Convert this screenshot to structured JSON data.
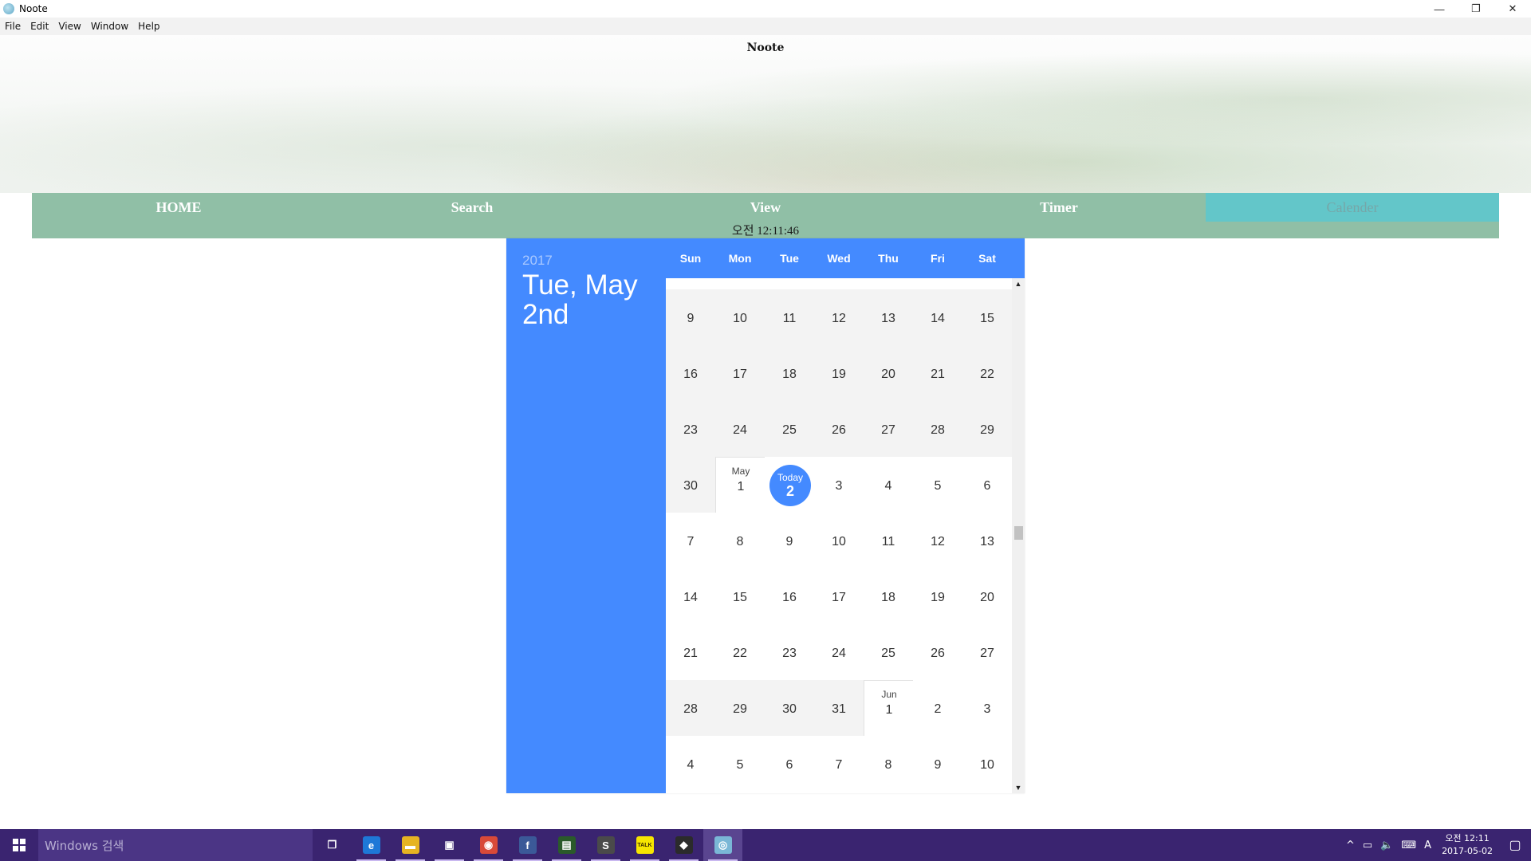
{
  "window": {
    "title": "Noote",
    "minimize_glyph": "—",
    "restore_glyph": "❐",
    "close_glyph": "✕"
  },
  "menu": [
    "File",
    "Edit",
    "View",
    "Window",
    "Help"
  ],
  "banner": {
    "title": "Noote"
  },
  "nav": {
    "items": [
      "HOME",
      "Search",
      "View",
      "Timer",
      "Calender"
    ],
    "active": "Calender",
    "clock": "오전 12:11:46"
  },
  "calendar": {
    "year": "2017",
    "selected_date": "Tue, May 2nd",
    "weekdays": [
      "Sun",
      "Mon",
      "Tue",
      "Wed",
      "Thu",
      "Fri",
      "Sat"
    ],
    "today_label": "Today",
    "weeks": [
      [
        {
          "d": "9"
        },
        {
          "d": "10"
        },
        {
          "d": "11"
        },
        {
          "d": "12"
        },
        {
          "d": "13"
        },
        {
          "d": "14"
        },
        {
          "d": "15"
        }
      ],
      [
        {
          "d": "16"
        },
        {
          "d": "17"
        },
        {
          "d": "18"
        },
        {
          "d": "19"
        },
        {
          "d": "20"
        },
        {
          "d": "21"
        },
        {
          "d": "22"
        }
      ],
      [
        {
          "d": "23"
        },
        {
          "d": "24"
        },
        {
          "d": "25"
        },
        {
          "d": "26"
        },
        {
          "d": "27"
        },
        {
          "d": "28"
        },
        {
          "d": "29"
        }
      ],
      [
        {
          "d": "30"
        },
        {
          "d": "1",
          "month": "May"
        },
        {
          "d": "2",
          "today": true
        },
        {
          "d": "3"
        },
        {
          "d": "4"
        },
        {
          "d": "5"
        },
        {
          "d": "6"
        }
      ],
      [
        {
          "d": "7"
        },
        {
          "d": "8"
        },
        {
          "d": "9"
        },
        {
          "d": "10"
        },
        {
          "d": "11"
        },
        {
          "d": "12"
        },
        {
          "d": "13"
        }
      ],
      [
        {
          "d": "14"
        },
        {
          "d": "15"
        },
        {
          "d": "16"
        },
        {
          "d": "17"
        },
        {
          "d": "18"
        },
        {
          "d": "19"
        },
        {
          "d": "20"
        }
      ],
      [
        {
          "d": "21"
        },
        {
          "d": "22"
        },
        {
          "d": "23"
        },
        {
          "d": "24"
        },
        {
          "d": "25"
        },
        {
          "d": "26"
        },
        {
          "d": "27"
        }
      ],
      [
        {
          "d": "28"
        },
        {
          "d": "29"
        },
        {
          "d": "30"
        },
        {
          "d": "31"
        },
        {
          "d": "1",
          "month": "Jun"
        },
        {
          "d": "2"
        },
        {
          "d": "3"
        }
      ],
      [
        {
          "d": "4"
        },
        {
          "d": "5"
        },
        {
          "d": "6"
        },
        {
          "d": "7"
        },
        {
          "d": "8"
        },
        {
          "d": "9"
        },
        {
          "d": "10"
        }
      ]
    ],
    "scroll_up": "▲",
    "scroll_down": "▼"
  },
  "taskbar": {
    "search_placeholder": "Windows 검색",
    "apps": [
      {
        "name": "task-view-icon",
        "glyph": "❐",
        "color": "transparent"
      },
      {
        "name": "edge-icon",
        "glyph": "e",
        "color": "#1e78d7"
      },
      {
        "name": "file-explorer-icon",
        "glyph": "▬",
        "color": "#e6b422"
      },
      {
        "name": "store-icon",
        "glyph": "▣",
        "color": "transparent"
      },
      {
        "name": "chrome-icon",
        "glyph": "◉",
        "color": "#d84a38"
      },
      {
        "name": "facebook-icon",
        "glyph": "f",
        "color": "#3b5998"
      },
      {
        "name": "terminal-icon",
        "glyph": "▤",
        "color": "#2a5a2a"
      },
      {
        "name": "sublime-icon",
        "glyph": "S",
        "color": "#4a4a4a"
      },
      {
        "name": "kakaotalk-icon",
        "glyph": "TALK",
        "color": "#f7e600"
      },
      {
        "name": "git-icon",
        "glyph": "◆",
        "color": "#2b2b2b"
      },
      {
        "name": "noote-app-icon",
        "glyph": "◎",
        "color": "#7ab7d6"
      }
    ],
    "tray_glyphs": [
      "^",
      "▭",
      "🔈",
      "⌨",
      "A"
    ],
    "time": "오전 12:11",
    "date": "2017-05-02",
    "notification_glyph": "▢"
  }
}
